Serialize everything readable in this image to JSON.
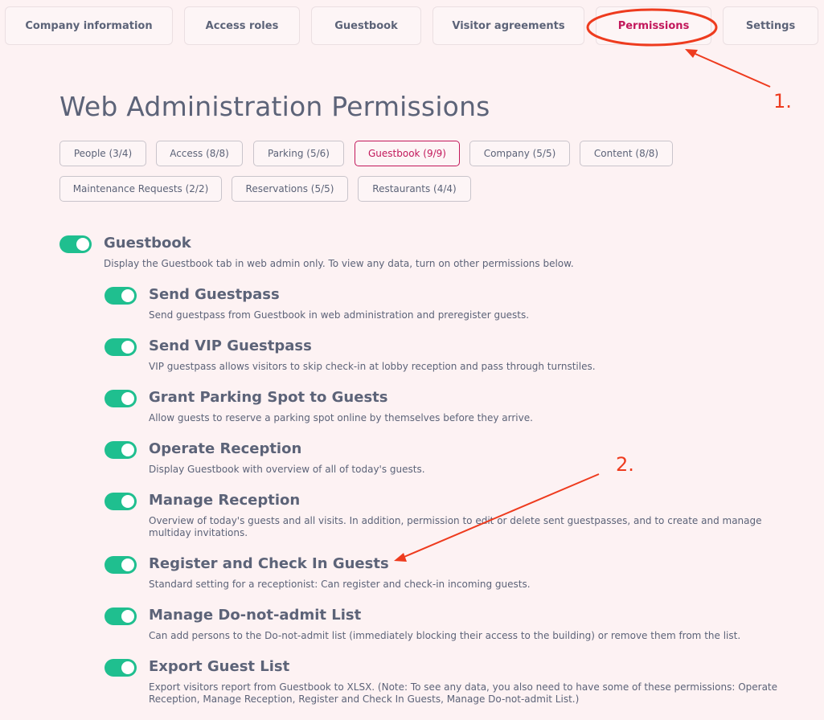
{
  "tabs": [
    {
      "label": "Company information"
    },
    {
      "label": "Access roles"
    },
    {
      "label": "Guestbook"
    },
    {
      "label": "Visitor agreements"
    },
    {
      "label": "Permissions"
    },
    {
      "label": "Settings"
    }
  ],
  "annotations": {
    "step1": "1.",
    "step2": "2."
  },
  "colors": {
    "accent": "#c2185b",
    "toggle_on": "#1fbf8f",
    "annotation": "#ee3b1e"
  },
  "page_title": "Web Administration Permissions",
  "chips": [
    {
      "label": "People  (3/4)"
    },
    {
      "label": "Access  (8/8)"
    },
    {
      "label": "Parking  (5/6)"
    },
    {
      "label": "Guestbook  (9/9)"
    },
    {
      "label": "Company  (5/5)"
    },
    {
      "label": "Content  (8/8)"
    },
    {
      "label": "Maintenance Requests  (2/2)"
    },
    {
      "label": "Reservations  (5/5)"
    },
    {
      "label": "Restaurants  (4/4)"
    }
  ],
  "permissions": [
    {
      "title": "Guestbook",
      "desc": "Display the Guestbook tab in web admin only. To view any data, turn on other permissions below.",
      "enabled": true
    },
    {
      "title": "Send Guestpass",
      "desc": "Send guestpass from Guestbook in web administration and preregister guests.",
      "enabled": true
    },
    {
      "title": "Send VIP Guestpass",
      "desc": "VIP guestpass allows visitors to skip check-in at lobby reception and pass through turnstiles.",
      "enabled": true
    },
    {
      "title": "Grant Parking Spot to Guests",
      "desc": "Allow guests to reserve a parking spot online by themselves before they arrive.",
      "enabled": true
    },
    {
      "title": "Operate Reception",
      "desc": "Display Guestbook with overview of all of today's guests.",
      "enabled": true
    },
    {
      "title": "Manage Reception",
      "desc": "Overview of today's guests and all visits. In addition, permission to edit or delete sent guestpasses, and to create and manage multiday invitations.",
      "enabled": true
    },
    {
      "title": "Register and Check In Guests",
      "desc": "Standard setting for a receptionist: Can register and check-in incoming guests.",
      "enabled": true
    },
    {
      "title": "Manage Do-not-admit List",
      "desc": "Can add persons to the Do-not-admit list (immediately blocking their access to the building) or remove them from the list.",
      "enabled": true
    },
    {
      "title": "Export Guest List",
      "desc": "Export visitors report from Guestbook to XLSX. (Note: To see any data, you also need to have some of these permissions: Operate Reception, Manage Reception, Register and Check In Guests, Manage Do-not-admit List.)",
      "enabled": true
    }
  ]
}
